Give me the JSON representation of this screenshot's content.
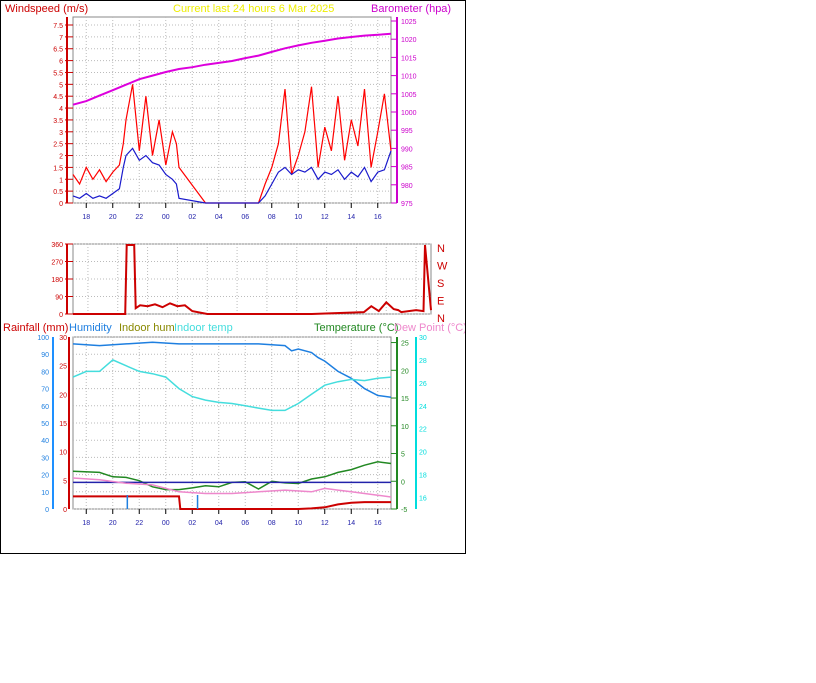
{
  "header": {
    "windspeed_label": "Windspeed (m/s)",
    "title": "Current last 24 hours 6 Mar 2025",
    "barometer_label": "Barometer (hpa)"
  },
  "legend": {
    "rainfall": "Rainfall (mm)",
    "humidity": "Humidity",
    "indoor_hum": "Indoor hum",
    "indoor_temp": "Indoor temp",
    "temperature": "Temperature (°C)",
    "dew_point": "Dew Point (°C)"
  },
  "colors": {
    "wind_gust": "#ff0000",
    "wind_avg": "#1a1acc",
    "barometer": "#dd00dd",
    "direction": "#cc0000",
    "rainfall": "#cc0000",
    "humidity": "#1e7fe0",
    "indoor_hum": "#ee88cc",
    "indoor_temp": "#44dddd",
    "temperature": "#228822",
    "dew_point": "#2222aa",
    "axis_blue": "#1e90ff",
    "axis_cyan": "#00dddd"
  },
  "chart_data": [
    {
      "type": "line",
      "id": "wind_pressure",
      "x_tick_labels": [
        "18",
        "20",
        "22",
        "00",
        "02",
        "04",
        "06",
        "08",
        "10",
        "12",
        "14",
        "16"
      ],
      "x_hours": [
        0,
        24
      ],
      "y_left_label": "Windspeed (m/s)",
      "y_left_ticks": [
        "0",
        "0.5",
        "1",
        "1.5",
        "2",
        "2.5",
        "3",
        "3.5",
        "4",
        "4.5",
        "5",
        "5.5",
        "6",
        "6.5",
        "7",
        "7.5"
      ],
      "y_left_range": [
        0,
        7.5
      ],
      "y_right_label": "Barometer (hpa)",
      "y_right_ticks": [
        "975",
        "980",
        "985",
        "990",
        "995",
        "1000",
        "1005",
        "1010",
        "1015",
        "1020",
        "1025"
      ],
      "y_right_range": [
        975,
        1025
      ],
      "grid": true,
      "series": [
        {
          "name": "gust",
          "color": "#ff0000",
          "x": [
            0,
            0.5,
            1,
            1.5,
            2,
            2.5,
            3,
            3.5,
            3.8,
            4,
            4.5,
            5,
            5.5,
            6,
            6.5,
            7,
            7.5,
            7.8,
            8,
            10,
            12,
            14,
            14.5,
            15,
            15.5,
            16,
            16.5,
            17,
            17.5,
            18,
            18.5,
            19,
            19.5,
            20,
            20.5,
            21,
            21.5,
            22,
            22.5,
            23,
            23.5,
            24
          ],
          "y": [
            1.2,
            0.8,
            1.5,
            1,
            1.4,
            0.9,
            1.3,
            1.6,
            2.5,
            3.5,
            5,
            2.2,
            4.5,
            2,
            3.5,
            1.6,
            3,
            2.5,
            1.5,
            0,
            0,
            0,
            0.8,
            1.5,
            2.5,
            4.8,
            1.2,
            2,
            3,
            4.9,
            1.5,
            3.2,
            2.2,
            4.5,
            1.8,
            3.5,
            2.4,
            4.8,
            1.5,
            3,
            4.6,
            2.2
          ]
        },
        {
          "name": "average",
          "color": "#1a1acc",
          "x": [
            0,
            0.5,
            1,
            1.5,
            2,
            2.5,
            3,
            3.5,
            3.8,
            4,
            4.5,
            5,
            5.5,
            6,
            6.5,
            7,
            7.5,
            7.8,
            8,
            10,
            12,
            14,
            14.5,
            15,
            15.5,
            16,
            16.5,
            17,
            17.5,
            18,
            18.5,
            19,
            19.5,
            20,
            20.5,
            21,
            21.5,
            22,
            22.5,
            23,
            23.5,
            24
          ],
          "y": [
            0.3,
            0.2,
            0.4,
            0.2,
            0.3,
            0.2,
            0.4,
            0.6,
            1.5,
            2,
            2.3,
            1.8,
            2,
            1.7,
            1.6,
            1.2,
            1,
            0.8,
            0.2,
            0,
            0,
            0,
            0.3,
            0.8,
            1.3,
            1.5,
            1.2,
            1.4,
            1.3,
            1.5,
            1,
            1.3,
            1.2,
            1.4,
            1,
            1.3,
            1.1,
            1.5,
            0.9,
            1.3,
            1.4,
            2.2
          ]
        },
        {
          "name": "pressure",
          "color": "#dd00dd",
          "x": [
            0,
            1,
            2,
            3,
            4,
            5,
            6,
            7,
            8,
            9,
            10,
            11,
            12,
            13,
            14,
            15,
            16,
            17,
            18,
            19,
            20,
            21,
            22,
            23,
            24
          ],
          "y": [
            1002,
            1003,
            1004.5,
            1006,
            1007.5,
            1009,
            1010,
            1011,
            1011.8,
            1012.3,
            1013,
            1013.5,
            1014,
            1014.8,
            1015.5,
            1016.5,
            1017.5,
            1018.3,
            1019,
            1019.6,
            1020.2,
            1020.6,
            1021,
            1021.2,
            1021.5
          ]
        }
      ]
    },
    {
      "type": "line",
      "id": "wind_direction",
      "x_hours": [
        0,
        24
      ],
      "y_ticks": [
        "0",
        "90",
        "180",
        "270",
        "360"
      ],
      "y_range": [
        0,
        360
      ],
      "compass_labels": [
        "N",
        "W",
        "S",
        "E",
        "N"
      ],
      "grid": true,
      "series": [
        {
          "name": "direction",
          "color": "#cc0000",
          "x": [
            0,
            3.5,
            3.6,
            4.1,
            4.2,
            4.5,
            5,
            5.5,
            6,
            6.5,
            7,
            7.5,
            8,
            9,
            10,
            12,
            14,
            16,
            19.5,
            20,
            20.5,
            21,
            21.5,
            21.8,
            22,
            23,
            23.5,
            23.6,
            24
          ],
          "y": [
            0,
            0,
            355,
            355,
            30,
            45,
            40,
            50,
            35,
            55,
            40,
            45,
            15,
            0,
            0,
            0,
            0,
            0,
            10,
            40,
            15,
            60,
            25,
            20,
            10,
            20,
            15,
            355,
            20
          ]
        }
      ]
    },
    {
      "type": "line",
      "id": "temperature_humidity_rain",
      "x_hours": [
        0,
        24
      ],
      "rain_ticks": [
        "0",
        "5",
        "10",
        "15",
        "20",
        "25",
        "30"
      ],
      "rain_range": [
        0,
        30
      ],
      "humidity_ticks": [
        "0",
        "10",
        "20",
        "30",
        "40",
        "50",
        "60",
        "70",
        "80",
        "90",
        "100"
      ],
      "humidity_range": [
        0,
        100
      ],
      "temperature_ticks": [
        "-5",
        "0",
        "5",
        "10",
        "15",
        "20",
        "25"
      ],
      "temperature_range": [
        -5,
        26
      ],
      "indoor_temp_ticks": [
        "16",
        "18",
        "20",
        "22",
        "24",
        "26",
        "28",
        "30"
      ],
      "indoor_temp_range": [
        15,
        30
      ],
      "grid": true,
      "series": [
        {
          "name": "Humidity",
          "color": "#1e7fe0",
          "x": [
            0,
            2,
            4,
            6,
            8,
            10,
            12,
            14,
            16,
            16.5,
            17,
            18,
            18.5,
            19,
            20,
            21,
            22,
            23,
            24
          ],
          "y": [
            96,
            95,
            96,
            97,
            96,
            96,
            96,
            96,
            95,
            92,
            93,
            91,
            88,
            86,
            80,
            76,
            70,
            66,
            65
          ]
        },
        {
          "name": "Indoor temp",
          "color": "#44dddd",
          "x": [
            0,
            1,
            2,
            3,
            4,
            5,
            6,
            7,
            8,
            9,
            10,
            11,
            12,
            13,
            14,
            15,
            16,
            17,
            18,
            19,
            20,
            21,
            22,
            23,
            24
          ],
          "y": [
            26.5,
            27,
            27,
            28,
            27.5,
            27,
            26.8,
            26.5,
            25.5,
            24.8,
            24.5,
            24.3,
            24.2,
            24,
            23.8,
            23.6,
            23.6,
            24.2,
            25,
            25.8,
            26.1,
            26.3,
            26.2,
            26.4,
            26.5
          ]
        },
        {
          "name": "Temperature",
          "color": "#228822",
          "x": [
            0,
            2,
            3,
            4,
            5,
            6,
            7,
            8,
            9,
            10,
            11,
            12,
            13,
            14,
            15,
            16,
            17,
            18,
            19,
            20,
            21,
            22,
            23,
            24
          ],
          "y": [
            1.8,
            1.6,
            0.8,
            0.7,
            0.1,
            -1.0,
            -1.5,
            -1.5,
            -1.2,
            -0.8,
            -1,
            -0.2,
            -0.1,
            -1.4,
            0,
            -0.3,
            -0.4,
            0.4,
            0.8,
            1.6,
            2.1,
            2.9,
            3.5,
            3.2
          ]
        },
        {
          "name": "Dew Point",
          "color": "#2222aa",
          "x": [
            0,
            24
          ],
          "y": [
            -0.2,
            -0.2
          ]
        },
        {
          "name": "Indoor hum",
          "color": "#ee88cc",
          "x": [
            0,
            2,
            4,
            6,
            8,
            10,
            12,
            14,
            16,
            18,
            19,
            20,
            21,
            22,
            23,
            24
          ],
          "y": [
            18,
            17,
            15,
            14,
            10,
            9,
            9,
            10,
            11,
            10,
            12,
            11,
            10,
            9,
            8,
            7
          ]
        },
        {
          "name": "Rainfall",
          "color": "#cc0000",
          "x": [
            0,
            8,
            8.1,
            17,
            18,
            19,
            20,
            21,
            22,
            24
          ],
          "y": [
            2.2,
            2.2,
            0,
            0,
            0.1,
            0.3,
            0.8,
            1.1,
            1.2,
            1.2
          ]
        }
      ]
    }
  ]
}
